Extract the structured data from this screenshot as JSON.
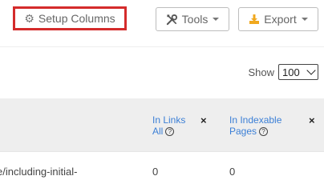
{
  "toolbar": {
    "setup_columns_label": "Setup Columns",
    "tools_label": "Tools",
    "export_label": "Export"
  },
  "show": {
    "label": "Show",
    "selected": "100"
  },
  "table": {
    "columns": [
      {
        "line1": "In Links",
        "line2": "All"
      },
      {
        "line1": "In Indexable",
        "line2": "Pages"
      }
    ],
    "close_symbol": "×",
    "rows": [
      {
        "url": "e/including-initial-",
        "in_links_all": "0",
        "in_indexable_pages": "0"
      }
    ]
  },
  "colors": {
    "highlight_border": "#d42b2b",
    "link_blue": "#3b7fd6",
    "header_bg": "#eeeeee",
    "export_icon": "#f0a81e"
  },
  "icons": {
    "setup": "gear-icon",
    "tools": "wrench-screwdriver-icon",
    "export": "download-icon",
    "help": "question-circle-icon",
    "remove": "close-icon"
  }
}
